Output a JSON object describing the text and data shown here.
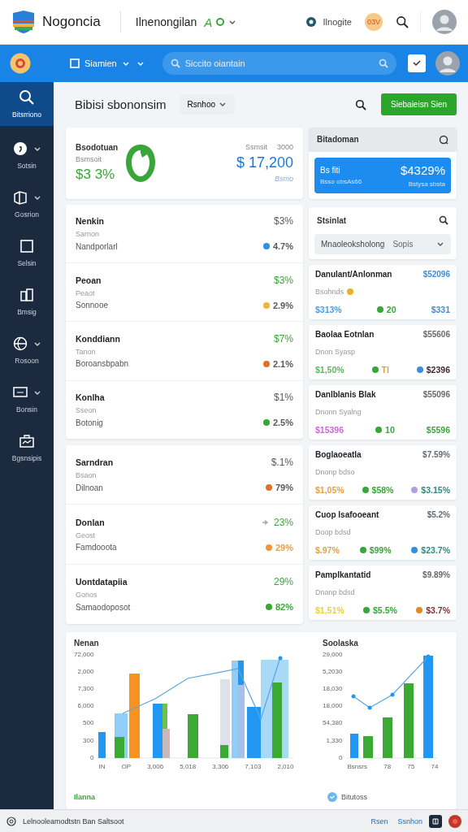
{
  "header": {
    "brand": "Nogoncia",
    "workspace": "Ilnenongilan",
    "workspace_mark": "A",
    "user_label": "Ilnogite",
    "badge": "03V"
  },
  "toolbar": {
    "menu_label": "Siamien",
    "search": {
      "placeholder": "Siccito oiantain"
    }
  },
  "sidebar": {
    "items": [
      {
        "label": "Bitsrriono",
        "selected": true,
        "expandable": false
      },
      {
        "label": "Sotsin",
        "selected": false,
        "expandable": true
      },
      {
        "label": "Gosrion",
        "selected": false,
        "expandable": true
      },
      {
        "label": "Selsin",
        "selected": false,
        "expandable": false
      },
      {
        "label": "Bmsig",
        "selected": false,
        "expandable": false
      },
      {
        "label": "Rosoon",
        "selected": false,
        "expandable": true
      },
      {
        "label": "Bonsin",
        "selected": false,
        "expandable": true
      },
      {
        "label": "Bgsnsipis",
        "selected": false,
        "expandable": false
      }
    ]
  },
  "page": {
    "title": "Bibisi sbononsim",
    "filter": "Rsnhoo",
    "action": "Siebaieisn Sien"
  },
  "summary": {
    "title": "Bsodotuan",
    "caption": "Bsmsoit",
    "value": "$3 3%",
    "right_caption": "Ssmsit",
    "right_caption_value": "3000",
    "amount": "$ 17,200",
    "amount_note": "Bsmo"
  },
  "list_a": {
    "rows": [
      {
        "title": "Nenkin",
        "subtitle": "Sarnon",
        "label": "Nandporlarl",
        "value": {
          "text": "$3%",
          "color": "#555a60"
        },
        "reading": {
          "text": "4.7%",
          "color": "#555a60"
        },
        "dot": {
          "color": "#2f8fe3"
        },
        "arrow": false
      },
      {
        "title": "Peoan",
        "subtitle": "Peaot",
        "label": "Sonnooe",
        "value": {
          "text": "$3%",
          "color": "#3aa63a"
        },
        "reading": {
          "text": "2.9%",
          "color": "#555a60"
        },
        "dot": {
          "color": "#f0b43c"
        },
        "arrow": false
      },
      {
        "title": "Konddiann",
        "subtitle": "Tanon",
        "label": "Boroansbpabn",
        "value": {
          "text": "$7%",
          "color": "#3aa63a"
        },
        "reading": {
          "text": "2.1%",
          "color": "#555a60"
        },
        "dot": {
          "color": "#e0702a"
        },
        "arrow": false
      },
      {
        "title": "Konlha",
        "subtitle": "Sseon",
        "label": "Botonig",
        "value": {
          "text": "$1%",
          "color": "#555a60"
        },
        "reading": {
          "text": "2.5%",
          "color": "#555a60"
        },
        "dot": {
          "color": "#3aa63a"
        },
        "arrow": false
      }
    ]
  },
  "list_b": {
    "rows": [
      {
        "title": "Sarndran",
        "subtitle": "Bsaon",
        "label": "Dilnoan",
        "value": {
          "text": "$.1%",
          "color": "#555a60"
        },
        "reading": {
          "text": "79%",
          "color": "#555a60"
        },
        "dot": {
          "color": "#e0702a"
        },
        "arrow": false
      },
      {
        "title": "Donlan",
        "subtitle": "Geost",
        "label": "Famdooota",
        "value": {
          "text": "23%",
          "color": "#3aa63a"
        },
        "reading": {
          "text": "29%",
          "color": "#e8a040"
        },
        "dot": {
          "color": "#f0963a"
        },
        "arrow": true
      },
      {
        "title": "Uontdatapiia",
        "subtitle": "Gonos",
        "label": "Samaodoposot",
        "value": {
          "text": "29%",
          "color": "#3aa63a"
        },
        "reading": {
          "text": "82%",
          "color": "#3aa63a"
        },
        "dot": {
          "color": "#3aa63a"
        },
        "arrow": false
      }
    ]
  },
  "balance": {
    "title": "Bitadoman",
    "label": "Bs fiti",
    "sublabel": "Bsso obsAs66",
    "amount": "$4329%",
    "note": "Bstysa sbsta"
  },
  "stat_filter": {
    "title": "Stsinlat",
    "select_value": "Mnaoleoksholong",
    "select_hint": "Sopis"
  },
  "stat_cards": [
    {
      "title": "Danulant/Anlonman",
      "amount": {
        "text": "$52096",
        "color": "#3f8fd6"
      },
      "subtitle": "Bsohnds",
      "subtitle_dot": {
        "color": "#e6b422"
      },
      "figures": [
        {
          "text": "$313%",
          "color": "#4a9ee0"
        },
        {
          "text": "20",
          "color": "#3aa63a",
          "dot": {
            "color": "#3aa63a"
          }
        },
        {
          "text": "$331",
          "color": "#3f8fd6"
        }
      ]
    },
    {
      "title": "Baolaa Eotnlan",
      "amount": {
        "text": "$55606",
        "color": "#666b70"
      },
      "subtitle": "Dnon Syasp",
      "figures": [
        {
          "text": "$1,50%",
          "color": "#5cb85c"
        },
        {
          "text": "Tl",
          "color": "#d4a43a",
          "dot": {
            "color": "#3aa63a"
          }
        },
        {
          "text": "$2396",
          "color": "#40282c",
          "dot": {
            "color": "#3a8fe0"
          }
        }
      ]
    },
    {
      "title": "Danlblanis Blak",
      "amount": {
        "text": "$55096",
        "color": "#666b70"
      },
      "subtitle": "Dnonn Syalng",
      "figures": [
        {
          "text": "$15396",
          "color": "#c86ad8"
        },
        {
          "text": "10",
          "color": "#3aa63a",
          "dot": {
            "color": "#3aa63a"
          }
        },
        {
          "text": "$5596",
          "color": "#3aa63a"
        }
      ]
    },
    {
      "title": "Boglaoeatla",
      "amount": {
        "text": "$7.59%",
        "color": "#666b70"
      },
      "subtitle": "Dnonp bdso",
      "figures": [
        {
          "text": "$1,05%",
          "color": "#e8a040"
        },
        {
          "text": "$58%",
          "color": "#3aa63a",
          "dot": {
            "color": "#3aa63a"
          }
        },
        {
          "text": "$3.15%",
          "color": "#2e8a80",
          "dot": {
            "color": "#b0a0e0"
          }
        }
      ]
    },
    {
      "title": "Cuop lsafooeant",
      "amount": {
        "text": "$5.2%",
        "color": "#666b70"
      },
      "subtitle": "Doop bdsd",
      "figures": [
        {
          "text": "$.97%",
          "color": "#e8a040"
        },
        {
          "text": "$99%",
          "color": "#3aa63a",
          "dot": {
            "color": "#3aa63a"
          }
        },
        {
          "text": "$23.7%",
          "color": "#2e8a80",
          "dot": {
            "color": "#2f8fe3"
          }
        }
      ]
    },
    {
      "title": "Pamplkantatid",
      "amount": {
        "text": "$9.89%",
        "color": "#666b70"
      },
      "subtitle": "Dnanp bdsd",
      "figures": [
        {
          "text": "$1,51%",
          "color": "#e8d040"
        },
        {
          "text": "$5.5%",
          "color": "#3aa63a",
          "dot": {
            "color": "#3aa63a"
          }
        },
        {
          "text": "$3.7%",
          "color": "#803030",
          "dot": {
            "color": "#e08a2a"
          }
        }
      ]
    }
  ],
  "charts": {
    "left": {
      "title": "Nenan",
      "yticks": [
        "72,000",
        "2,000",
        "7,300",
        "6,000",
        "500",
        "300",
        "0"
      ],
      "xticks": [
        "IN",
        "OP",
        "3,006",
        "5,018",
        "3,306",
        "7,103",
        "2,010"
      ]
    },
    "right": {
      "title": "Soolaska",
      "yticks": [
        "29,000",
        "5,2030",
        "18,030",
        "18,000",
        "54,380",
        "1,330",
        "0"
      ],
      "xticks": [
        "Bsnsrs",
        "78",
        "75",
        "74"
      ]
    },
    "legend": {
      "label": "Ilanna",
      "toggle": "Bitutoss"
    }
  },
  "footer": {
    "text": "Lelnooleamodtstn Ban Saltsoot",
    "links": [
      "Rsen",
      "Ssnhon"
    ]
  }
}
